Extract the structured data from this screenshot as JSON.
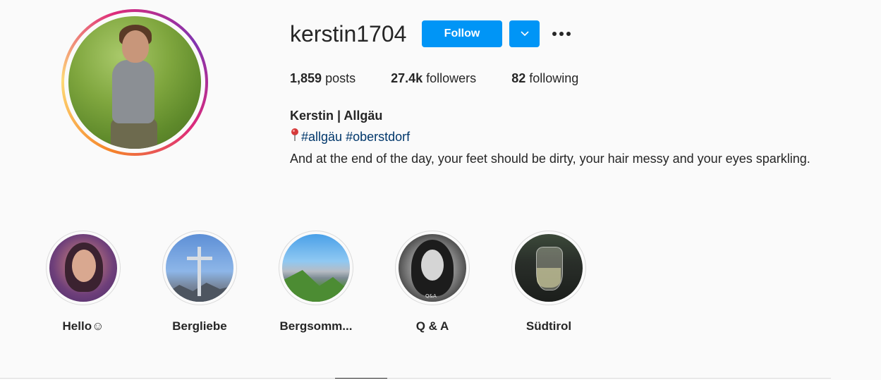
{
  "profile": {
    "username": "kerstin1704",
    "follow_label": "Follow",
    "stats": {
      "posts_count": "1,859",
      "posts_label": "posts",
      "followers_count": "27.4k",
      "followers_label": "followers",
      "following_count": "82",
      "following_label": "following"
    },
    "bio": {
      "name": "Kerstin | Allgäu",
      "tag1": "#allgäu",
      "tag2": "#oberstdorf",
      "text": "And at the end of the day, your feet should be dirty, your hair messy and your eyes sparkling."
    }
  },
  "highlights": [
    {
      "label": "Hello☺"
    },
    {
      "label": "Bergliebe"
    },
    {
      "label": "Bergsomm..."
    },
    {
      "label": "Q & A"
    },
    {
      "label": "Südtirol"
    }
  ],
  "qa_badge": "Q&A",
  "colors": {
    "accent": "#0095f6",
    "hashtag": "#00376b",
    "text": "#262626",
    "background": "#fafafa"
  },
  "icons": {
    "dropdown": "chevron-down-icon",
    "more": "more-dots-icon",
    "pin": "pin-icon"
  }
}
